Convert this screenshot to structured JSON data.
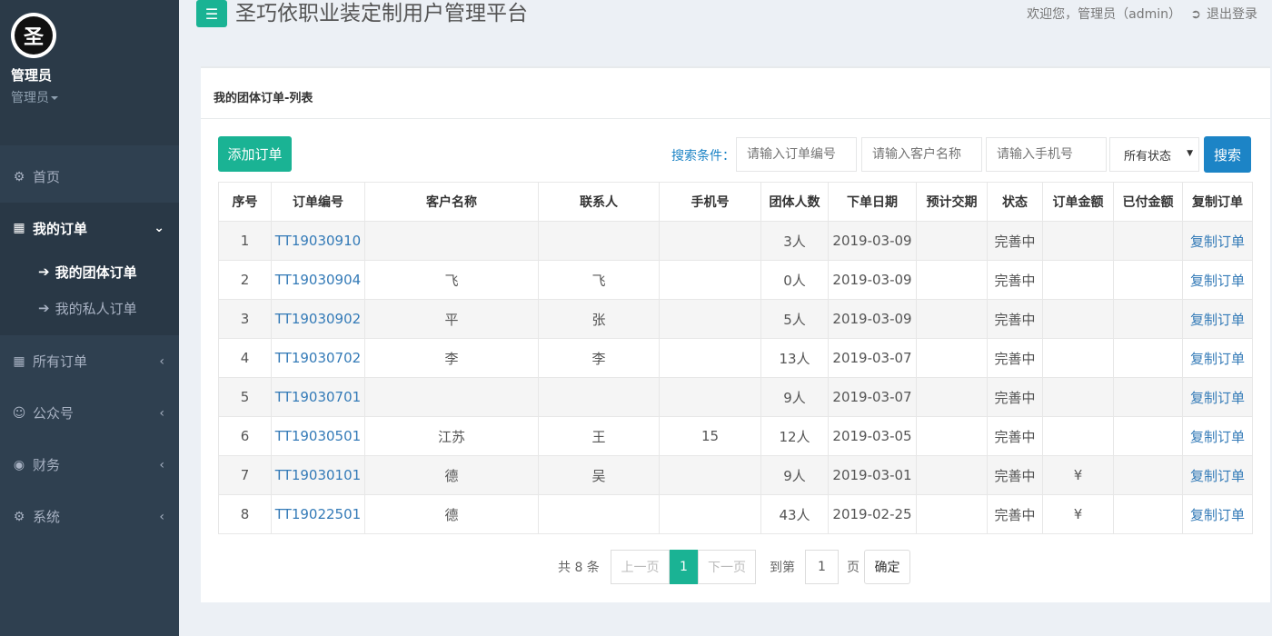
{
  "sidebar": {
    "logo_char": "圣",
    "user_name": "管理员",
    "user_role": "管理员",
    "items": [
      {
        "icon": "home-icon",
        "label": "首页"
      },
      {
        "icon": "grid-icon",
        "label": "我的订单",
        "sub": [
          {
            "label": "我的团体订单"
          },
          {
            "label": "我的私人订单"
          }
        ]
      },
      {
        "icon": "grid-icon",
        "label": "所有订单"
      },
      {
        "icon": "users-icon",
        "label": "公众号"
      },
      {
        "icon": "eye-icon",
        "label": "财务"
      },
      {
        "icon": "gear-icon",
        "label": "系统"
      }
    ]
  },
  "header": {
    "title": "圣巧依职业装定制用户管理平台",
    "welcome": "欢迎您，管理员（admin）",
    "logout": "退出登录"
  },
  "panel": {
    "title": "我的团体订单-列表",
    "add_button": "添加订单",
    "search_label": "搜索条件：",
    "order_placeholder": "请输入订单编号",
    "customer_placeholder": "请输入客户名称",
    "phone_placeholder": "请输入手机号",
    "status_select": "所有状态",
    "search_button": "搜索"
  },
  "table": {
    "headers": [
      "序号",
      "订单编号",
      "客户名称",
      "联系人",
      "手机号",
      "团体人数",
      "下单日期",
      "预计交期",
      "状态",
      "订单金额",
      "已付金额",
      "复制订单"
    ],
    "rows": [
      {
        "no": "1",
        "order": "TT19030910",
        "customer": "",
        "contact": "",
        "phone": "",
        "count": "3人",
        "date": "2019-03-09",
        "eta": "",
        "status": "完善中",
        "amount": "",
        "paid": "",
        "copy": "复制订单"
      },
      {
        "no": "2",
        "order": "TT19030904",
        "customer": "飞",
        "contact": "飞",
        "phone": "",
        "count": "0人",
        "date": "2019-03-09",
        "eta": "",
        "status": "完善中",
        "amount": "",
        "paid": "",
        "copy": "复制订单"
      },
      {
        "no": "3",
        "order": "TT19030902",
        "customer": "平",
        "contact": "张",
        "phone": "",
        "count": "5人",
        "date": "2019-03-09",
        "eta": "",
        "status": "完善中",
        "amount": "",
        "paid": "",
        "copy": "复制订单"
      },
      {
        "no": "4",
        "order": "TT19030702",
        "customer": "李",
        "contact": "李",
        "phone": "",
        "count": "13人",
        "date": "2019-03-07",
        "eta": "",
        "status": "完善中",
        "amount": "",
        "paid": "",
        "copy": "复制订单"
      },
      {
        "no": "5",
        "order": "TT19030701",
        "customer": "",
        "contact": "",
        "phone": "",
        "count": "9人",
        "date": "2019-03-07",
        "eta": "",
        "status": "完善中",
        "amount": "",
        "paid": "",
        "copy": "复制订单"
      },
      {
        "no": "6",
        "order": "TT19030501",
        "customer": "江苏",
        "contact": "王",
        "phone": "15",
        "count": "12人",
        "date": "2019-03-05",
        "eta": "",
        "status": "完善中",
        "amount": "",
        "paid": "",
        "copy": "复制订单"
      },
      {
        "no": "7",
        "order": "TT19030101",
        "customer": "德",
        "contact": "吴",
        "phone": "",
        "count": "9人",
        "date": "2019-03-01",
        "eta": "",
        "status": "完善中",
        "amount": "¥",
        "paid": "",
        "copy": "复制订单"
      },
      {
        "no": "8",
        "order": "TT19022501",
        "customer": "德",
        "contact": "",
        "phone": "",
        "count": "43人",
        "date": "2019-02-25",
        "eta": "",
        "status": "完善中",
        "amount": "¥",
        "paid": "",
        "copy": "复制订单"
      }
    ]
  },
  "pager": {
    "total": "共 8 条",
    "prev": "上一页",
    "current": "1",
    "next": "下一页",
    "goto": "到第",
    "page_value": "1",
    "page_unit": "页",
    "confirm": "确定"
  }
}
